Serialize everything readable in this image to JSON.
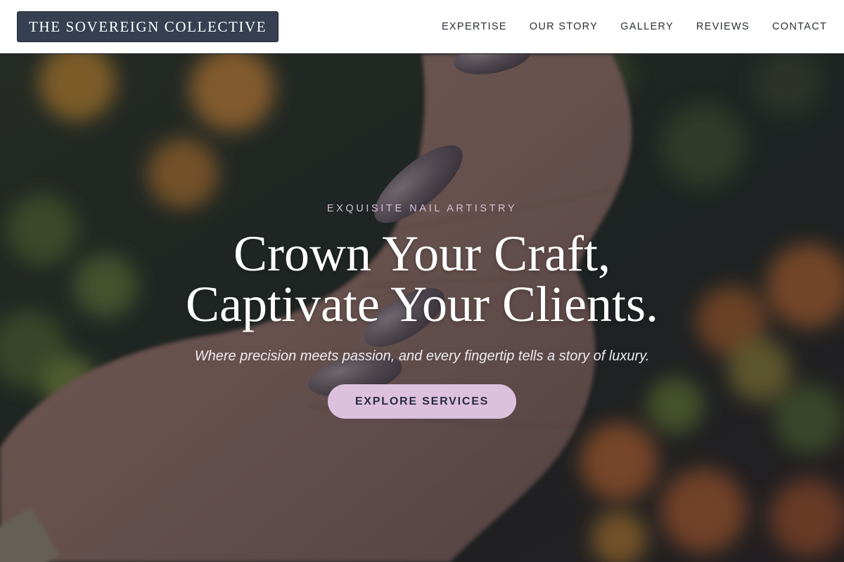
{
  "brand": {
    "name": "THE SOVEREIGN COLLECTIVE"
  },
  "nav": {
    "items": [
      {
        "label": "EXPERTISE"
      },
      {
        "label": "OUR STORY"
      },
      {
        "label": "GALLERY"
      },
      {
        "label": "REVIEWS"
      },
      {
        "label": "CONTACT"
      }
    ]
  },
  "hero": {
    "eyebrow": "EXQUISITE NAIL ARTISTRY",
    "headline_line1": "Crown Your Craft,",
    "headline_line2": "Captivate Your Clients.",
    "subtitle": "Where precision meets passion, and every fingertip tells a story of luxury.",
    "cta_label": "EXPLORE SERVICES",
    "background": "hand-with-almond-nails-over-marigold-flowers-photo"
  },
  "colors": {
    "logo_bg": "#364052",
    "nav_text": "#2b2f38",
    "eyebrow": "#d7bfdc",
    "cta_bg": "#dcc0de",
    "cta_text": "#2a2c44",
    "nail_polish": "#6a5c62"
  }
}
